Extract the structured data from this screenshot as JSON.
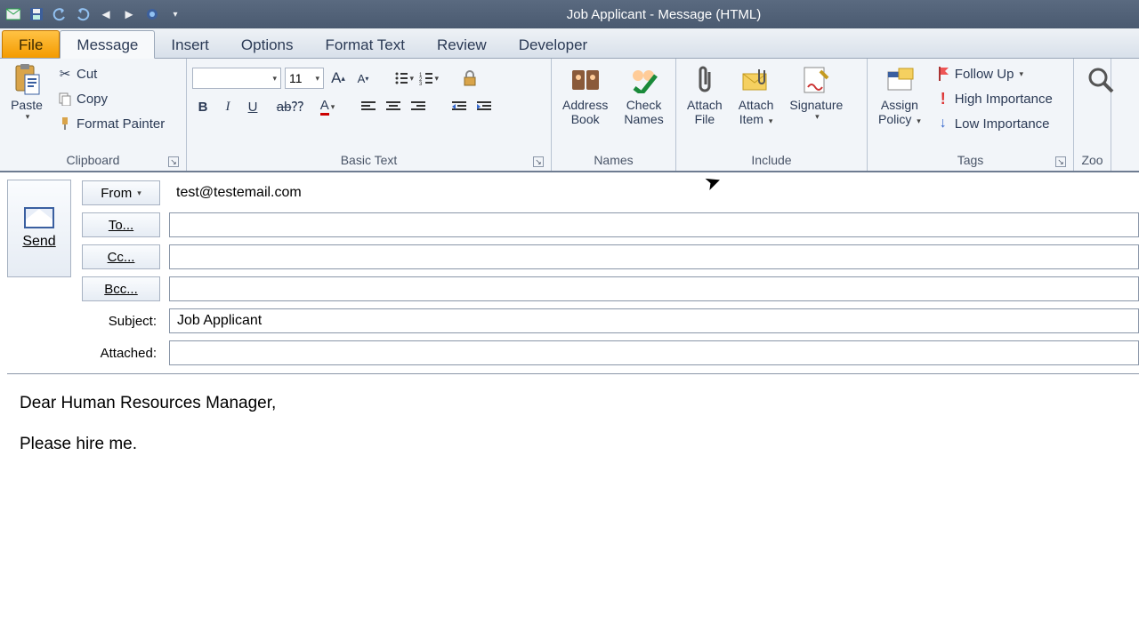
{
  "window": {
    "title": "Job Applicant - Message (HTML)"
  },
  "tabs": {
    "file": "File",
    "message": "Message",
    "insert": "Insert",
    "options": "Options",
    "format": "Format Text",
    "review": "Review",
    "developer": "Developer"
  },
  "ribbon": {
    "clipboard": {
      "label": "Clipboard",
      "paste": "Paste",
      "cut": "Cut",
      "copy": "Copy",
      "painter": "Format Painter"
    },
    "basictext": {
      "label": "Basic Text",
      "font_size": "11"
    },
    "names": {
      "label": "Names",
      "addressbook_l1": "Address",
      "addressbook_l2": "Book",
      "check_l1": "Check",
      "check_l2": "Names"
    },
    "include": {
      "label": "Include",
      "attachfile_l1": "Attach",
      "attachfile_l2": "File",
      "attachitem_l1": "Attach",
      "attachitem_l2": "Item",
      "signature": "Signature"
    },
    "tags": {
      "label": "Tags",
      "assign_l1": "Assign",
      "assign_l2": "Policy",
      "followup": "Follow Up",
      "high": "High Importance",
      "low": "Low Importance"
    },
    "zoom": {
      "label": "Zoo"
    }
  },
  "compose": {
    "send": "Send",
    "from_btn": "From",
    "from_value": "test@testemail.com",
    "to_btn": "To...",
    "cc_btn": "Cc...",
    "bcc_btn": "Bcc...",
    "subject_label": "Subject:",
    "subject_value": "Job Applicant",
    "attached_label": "Attached:"
  },
  "body": {
    "p1": "Dear Human Resources Manager,",
    "p2": "Please hire me."
  }
}
